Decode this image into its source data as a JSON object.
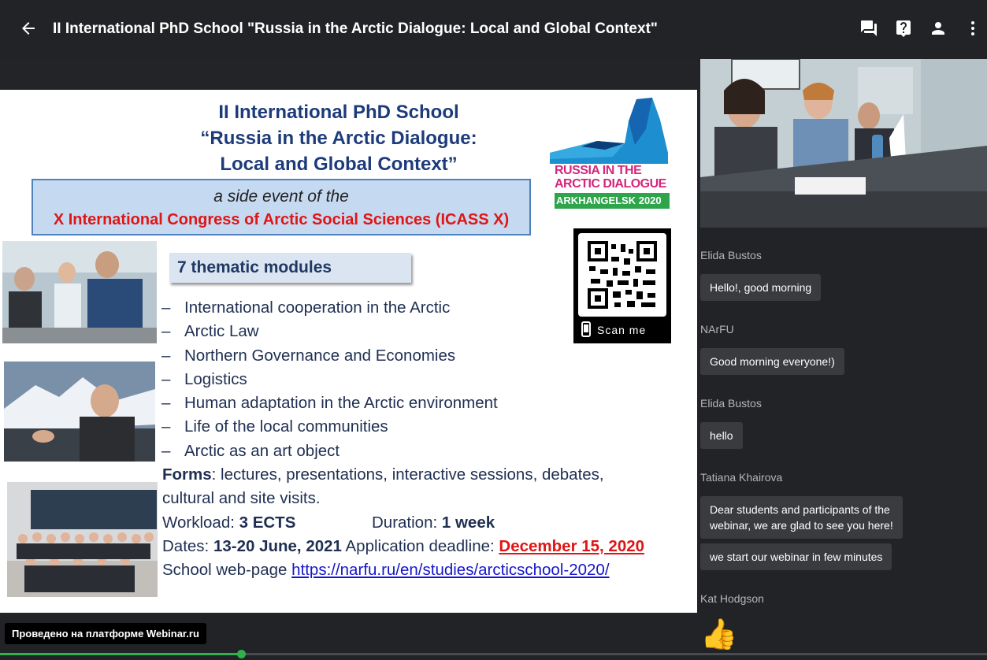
{
  "header": {
    "title": "II International PhD School \"Russia in the Arctic Dialogue: Local and Global Context\"",
    "icons": [
      "back-arrow-icon",
      "chat-icon",
      "help-icon",
      "user-icon",
      "more-vertical-icon"
    ]
  },
  "slide": {
    "heading": [
      "II International PhD School",
      "“Russia in the Arctic Dialogue:",
      "Local and Global Context”"
    ],
    "side_event_line1": "a side event of the",
    "side_event_line2": "X International Congress of Arctic Social Sciences (ICASS X)",
    "logo": {
      "line1": "RUSSIA IN THE",
      "line2": "ARCTIC DIALOGUE",
      "line3": "ARKHANGELSK 2020"
    },
    "qr_label": "Scan me",
    "modules_heading": "7 thematic modules",
    "modules": [
      "International cooperation in the Arctic",
      "Arctic Law",
      "Northern Governance and Economies",
      "Logistics",
      "Human adaptation in the Arctic environment",
      "Life of the local communities",
      "Arctic as an art object"
    ],
    "module_dash": "–",
    "forms_label": "Forms",
    "forms_text": ": lectures, presentations, interactive sessions, debates,",
    "forms_text2": "cultural and site visits.",
    "workload_label": "Workload: ",
    "workload_value": "3 ECTS",
    "duration_label": "Duration: ",
    "duration_value": "1 week",
    "dates_label": "Dates: ",
    "dates_value": "13-20 June, 2021",
    "deadline_label": " Application deadline: ",
    "deadline_value": "December 15, 2020",
    "webpage_label": "School web-page ",
    "webpage_url": "https://narfu.ru/en/studies/arcticschool-2020/"
  },
  "chat": {
    "messages": [
      {
        "author": "Elida Bustos",
        "texts": [
          "Hello!, good morning"
        ]
      },
      {
        "author": "NArFU",
        "texts": [
          "Good morning everyone!)"
        ]
      },
      {
        "author": "Elida Bustos",
        "texts": [
          "hello"
        ]
      },
      {
        "author": "Tatiana Khairova",
        "texts": [
          "Dear students and participants of the",
          "webinar, we are glad to see you here!",
          "we start our webinar in few minutes"
        ]
      },
      {
        "author": "Kat Hodgson",
        "texts": [
          "👍"
        ]
      }
    ]
  },
  "footer": {
    "badge": "Проведено на платформе Webinar.ru",
    "progress_fraction": 0.244
  },
  "colors": {
    "accent": "#2fb24c",
    "background": "#222326",
    "bubble": "#3a3b3f"
  }
}
